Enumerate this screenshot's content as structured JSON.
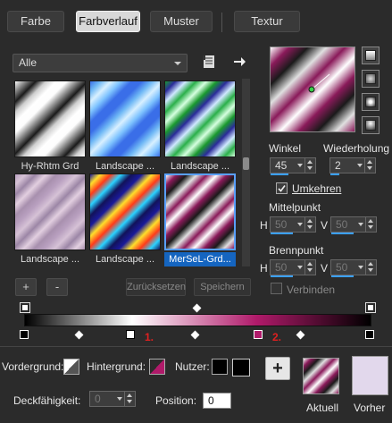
{
  "tabs": [
    {
      "label": "Farbe"
    },
    {
      "label": "Farbverlauf",
      "active": true
    },
    {
      "label": "Muster"
    },
    {
      "label": "Textur"
    }
  ],
  "category_dropdown": {
    "value": "Alle"
  },
  "gradients": [
    {
      "name": "Hy-Rhtm Grd",
      "colors": [
        "#fdfdfd",
        "#8a8a8a",
        "#1a1a1a",
        "#cfcfcf",
        "#ffffff"
      ]
    },
    {
      "name": "Landscape ...",
      "colors": [
        "#3a6ee8",
        "#6fb8f5",
        "#d8f0ff",
        "#7ec3ff",
        "#3a6ee8"
      ]
    },
    {
      "name": "Landscape ...",
      "colors": [
        "#1a9a2e",
        "#2b2b9a",
        "#cfe8ff",
        "#2bb04a",
        "#d6ffe0"
      ]
    },
    {
      "name": "Landscape ...",
      "colors": [
        "#b9a0c0",
        "#d6c2d6",
        "#9c86a6",
        "#e2cfe0",
        "#a890ae"
      ]
    },
    {
      "name": "Landscape ...",
      "colors": [
        "#1a1a9a",
        "#ffde2b",
        "#ff3b1a",
        "#2bd2ff",
        "#12125a"
      ]
    },
    {
      "name": "MerSeL-Grd...",
      "colors": [
        "#ffffff",
        "#8a1a5a",
        "#1a1a1a",
        "#e0e0e0",
        "#8a1a5a"
      ],
      "selected": true
    }
  ],
  "buttons": {
    "add": "+",
    "remove": "-",
    "reset": "Zurücksetzen",
    "save": "Speichern"
  },
  "settings": {
    "angle_label": "Winkel",
    "angle_value": "45",
    "repeat_label": "Wiederholung",
    "repeat_value": "2",
    "invert_label": "Umkehren",
    "invert_checked": true,
    "center_label": "Mittelpunkt",
    "center_h_label": "H",
    "center_h_value": "50",
    "center_v_label": "V",
    "center_v_value": "50",
    "focus_label": "Brennpunkt",
    "focus_h_label": "H",
    "focus_h_value": "50",
    "focus_v_label": "V",
    "focus_v_value": "50",
    "link_label": "Verbinden"
  },
  "editor": {
    "marker1_label": "1.",
    "marker2_label": "2."
  },
  "bottom": {
    "foreground_label": "Vordergrund:",
    "background_label": "Hintergrund:",
    "user_label": "Nutzer:",
    "opacity_label": "Deckfähigkeit:",
    "opacity_value": "0",
    "position_label": "Position:",
    "position_value": "0",
    "current_label": "Aktuell",
    "previous_label": "Vorher",
    "add_label": "+"
  },
  "colors": {
    "accent": "#1565c0",
    "marker_pink": "#b01a6a",
    "highlight_red": "#e02020"
  }
}
